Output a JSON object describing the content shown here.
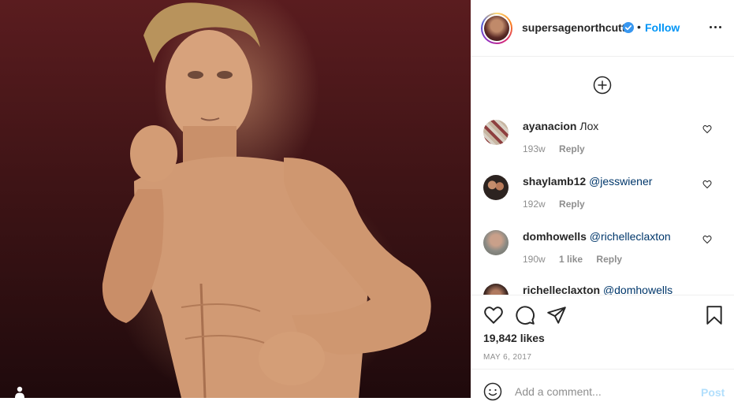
{
  "post": {
    "image_alt": "shirtless man in fighting stance against dark red background"
  },
  "header": {
    "username": "supersagenorthcutt",
    "verified": true,
    "separator": "•",
    "follow_label": "Follow",
    "more_icon": "more-horizontal-icon"
  },
  "comments_area": {
    "load_more_icon": "plus-circle-icon"
  },
  "comments": [
    {
      "username": "ayanacion",
      "text": "Лох",
      "mention": "",
      "time": "193w",
      "likes": "",
      "reply": "Reply"
    },
    {
      "username": "shaylamb12",
      "text": "",
      "mention": "@jesswiener",
      "time": "192w",
      "likes": "",
      "reply": "Reply"
    },
    {
      "username": "domhowells",
      "text": "",
      "mention": "@richelleclaxton",
      "time": "190w",
      "likes": "1 like",
      "reply": "Reply"
    },
    {
      "username": "richelleclaxton",
      "text": "",
      "mention": "@domhowells",
      "time": "",
      "likes": "",
      "reply": ""
    }
  ],
  "actions": {
    "like_icon": "heart-icon",
    "comment_icon": "comment-icon",
    "share_icon": "send-icon",
    "save_icon": "bookmark-icon",
    "likes_text": "19,842 likes",
    "date": "MAY 6, 2017"
  },
  "add_comment": {
    "placeholder": "Add a comment...",
    "post_label": "Post",
    "emoji_icon": "smiley-icon"
  },
  "colors": {
    "accent": "#0095f6",
    "post_disabled": "#b2dffc",
    "muted": "#8e8e8e",
    "mention": "#00376b"
  }
}
